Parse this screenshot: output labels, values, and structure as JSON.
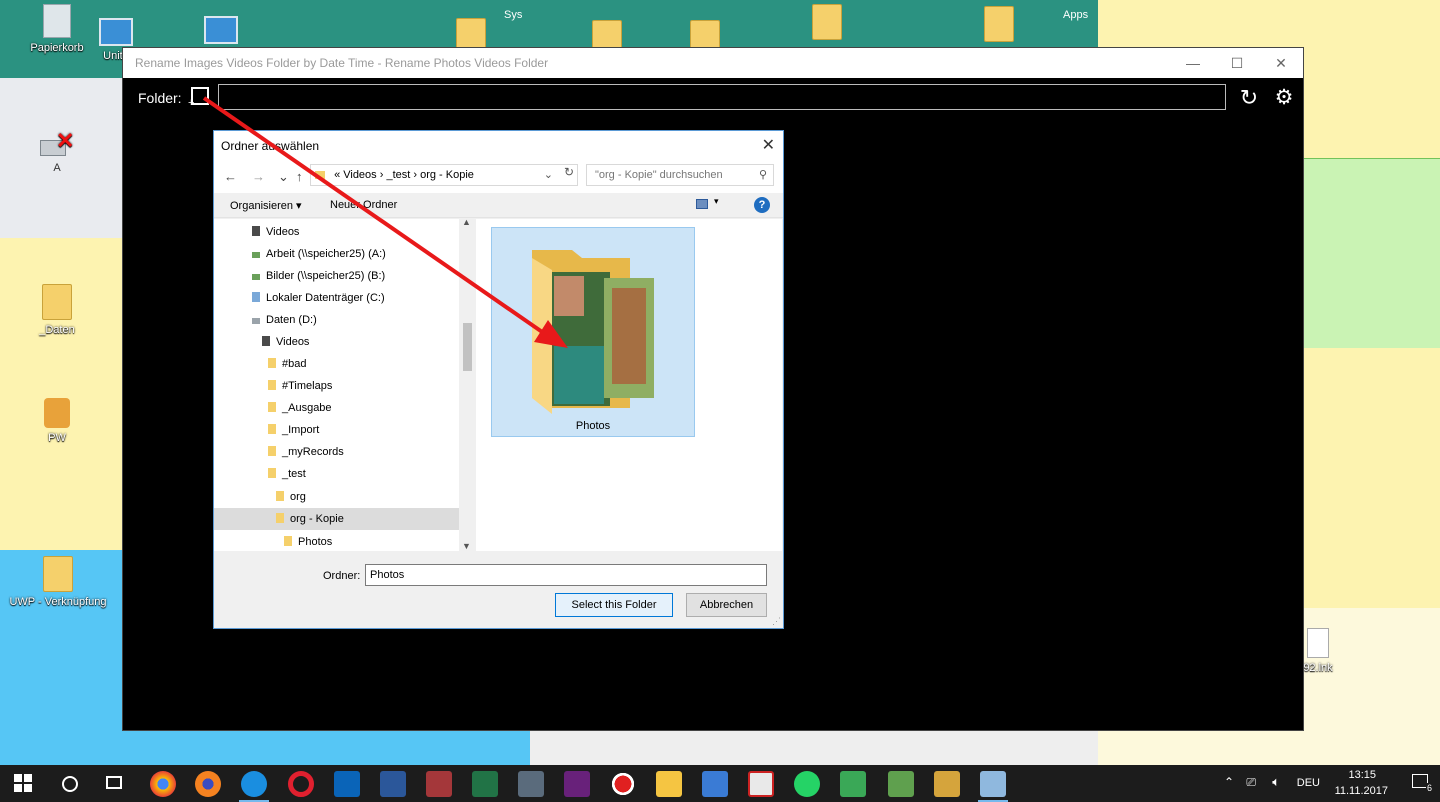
{
  "desktop": {
    "icons": [
      {
        "label": "Papierkorb"
      },
      {
        "label": "Unite"
      },
      {
        "label": "A"
      },
      {
        "label": "_Daten"
      },
      {
        "label": "PW"
      },
      {
        "label": "UWP - Verknüpfung"
      },
      {
        "label": "92.lnk"
      }
    ],
    "group_labels": [
      "Sys",
      "Apps"
    ]
  },
  "app_window": {
    "title": "Rename Images Videos Folder by Date Time - Rename Photos Videos Folder",
    "minimize_glyph": "—",
    "maximize_glyph": "☐",
    "close_glyph": "✕",
    "folder_label": "Folder:",
    "folder_value": "",
    "refresh_glyph": "↻",
    "settings_glyph": "⚙"
  },
  "dialog": {
    "title": "Ordner auswählen",
    "close_glyph": "✕",
    "nav": {
      "back": "←",
      "forward": "→",
      "recent": "⌄",
      "up": "↑"
    },
    "breadcrumb": "«  Videos  ›  _test  ›  org - Kopie",
    "search_placeholder": "\"org - Kopie\" durchsuchen",
    "organize_label": "Organisieren ▾",
    "new_folder_label": "Neuer Ordner",
    "help_glyph": "?",
    "tree": [
      {
        "label": "Videos",
        "indent": 0
      },
      {
        "label": "Arbeit (\\\\speicher25) (A:)",
        "indent": 0
      },
      {
        "label": "Bilder (\\\\speicher25) (B:)",
        "indent": 0
      },
      {
        "label": "Lokaler Datenträger (C:)",
        "indent": 0
      },
      {
        "label": "Daten (D:)",
        "indent": 0
      },
      {
        "label": "Videos",
        "indent": 1
      },
      {
        "label": "#bad",
        "indent": 2
      },
      {
        "label": "#Timelaps",
        "indent": 2
      },
      {
        "label": "_Ausgabe",
        "indent": 2
      },
      {
        "label": "_Import",
        "indent": 2
      },
      {
        "label": "_myRecords",
        "indent": 2
      },
      {
        "label": "_test",
        "indent": 2
      },
      {
        "label": "org",
        "indent": 3
      },
      {
        "label": "org - Kopie",
        "indent": 3,
        "selected": true
      },
      {
        "label": "Photos",
        "indent": 4
      }
    ],
    "content_item": "Photos",
    "folder_field_label": "Ordner:",
    "folder_field_value": "Photos",
    "select_button": "Select this Folder",
    "cancel_button": "Abbrechen"
  },
  "taskbar": {
    "language": "DEU",
    "time": "13:15",
    "date": "11.11.2017",
    "notifications": "6"
  },
  "colors": {
    "accent": "#0078d7",
    "annotation_arrow": "#e8191a"
  }
}
